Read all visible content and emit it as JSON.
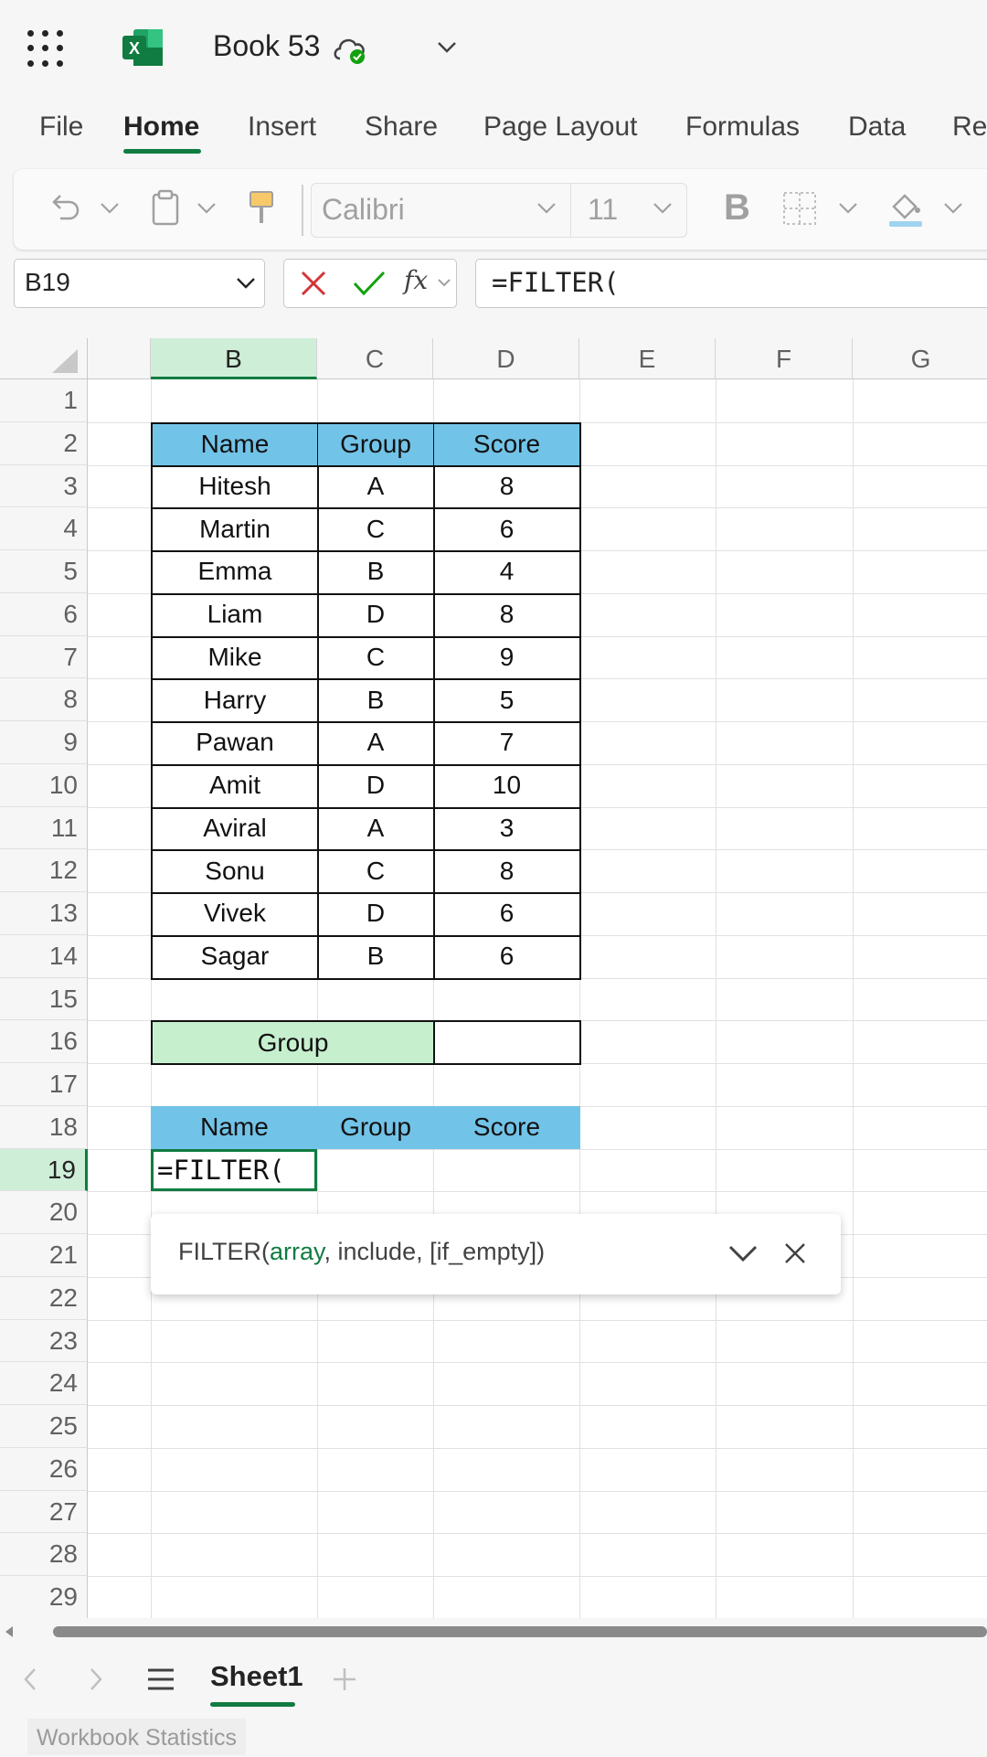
{
  "app": {
    "book_title": "Book 53"
  },
  "tabs": [
    {
      "label": "File"
    },
    {
      "label": "Home"
    },
    {
      "label": "Insert"
    },
    {
      "label": "Share"
    },
    {
      "label": "Page Layout"
    },
    {
      "label": "Formulas"
    },
    {
      "label": "Data"
    },
    {
      "label": "Re"
    }
  ],
  "ribbon": {
    "font_name": "Calibri",
    "font_size": "11",
    "bold_label": "B"
  },
  "formula_bar": {
    "name_box": "B19",
    "fx_label": "fx",
    "formula": "=FILTER("
  },
  "columns": [
    "B",
    "C",
    "D",
    "E",
    "F",
    "G"
  ],
  "rows": [
    "1",
    "2",
    "3",
    "4",
    "5",
    "6",
    "7",
    "8",
    "9",
    "10",
    "11",
    "12",
    "13",
    "14",
    "15",
    "16",
    "17",
    "18",
    "19",
    "20",
    "21",
    "22",
    "23",
    "24",
    "25",
    "26",
    "27",
    "28",
    "29"
  ],
  "table1": {
    "headers": [
      "Name",
      "Group",
      "Score"
    ],
    "rows": [
      [
        "Hitesh",
        "A",
        "8"
      ],
      [
        "Martin",
        "C",
        "6"
      ],
      [
        "Emma",
        "B",
        "4"
      ],
      [
        "Liam",
        "D",
        "8"
      ],
      [
        "Mike",
        "C",
        "9"
      ],
      [
        "Harry",
        "B",
        "5"
      ],
      [
        "Pawan",
        "A",
        "7"
      ],
      [
        "Amit",
        "D",
        "10"
      ],
      [
        "Aviral",
        "A",
        "3"
      ],
      [
        "Sonu",
        "C",
        "8"
      ],
      [
        "Vivek",
        "D",
        "6"
      ],
      [
        "Sagar",
        "B",
        "6"
      ]
    ]
  },
  "criteria": {
    "label": "Group",
    "value": ""
  },
  "table2": {
    "headers": [
      "Name",
      "Group",
      "Score"
    ],
    "active_cell_text": "=FILTER("
  },
  "tooltip": {
    "fn": "FILTER(",
    "arg_current": "array",
    "rest": ", include, [if_empty])"
  },
  "sheet": {
    "name": "Sheet1"
  },
  "status": {
    "workbook_statistics": "Workbook Statistics"
  },
  "colors": {
    "accent": "#107c41",
    "header_fill": "#72c3e8",
    "criteria_fill": "#c6efce"
  }
}
